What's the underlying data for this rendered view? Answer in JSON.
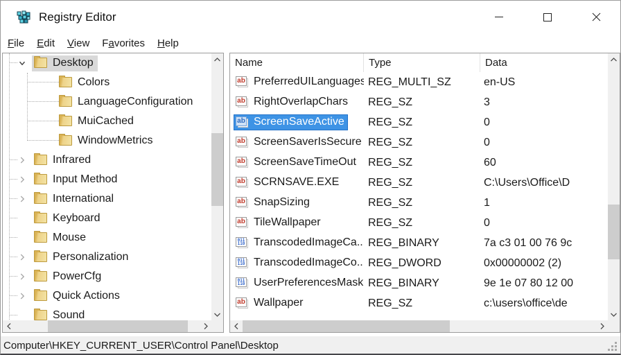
{
  "window": {
    "title": "Registry Editor"
  },
  "titlebar_controls": [
    {
      "name": "minimize-button",
      "icon": "minimize-icon"
    },
    {
      "name": "maximize-button",
      "icon": "maximize-icon"
    },
    {
      "name": "close-button",
      "icon": "close-icon"
    }
  ],
  "menu": {
    "items": [
      {
        "label": "File",
        "underline": 0
      },
      {
        "label": "Edit",
        "underline": 0
      },
      {
        "label": "View",
        "underline": 0
      },
      {
        "label": "Favorites",
        "underline": 1
      },
      {
        "label": "Help",
        "underline": 0
      }
    ]
  },
  "tree": {
    "items": [
      {
        "label": "Desktop",
        "level": 1,
        "expander": "expanded",
        "selected": true
      },
      {
        "label": "Colors",
        "level": 2,
        "expander": "none"
      },
      {
        "label": "LanguageConfiguration",
        "level": 2,
        "expander": "none"
      },
      {
        "label": "MuiCached",
        "level": 2,
        "expander": "none"
      },
      {
        "label": "WindowMetrics",
        "level": 2,
        "expander": "none"
      },
      {
        "label": "Infrared",
        "level": 1,
        "expander": "collapsed"
      },
      {
        "label": "Input Method",
        "level": 1,
        "expander": "collapsed"
      },
      {
        "label": "International",
        "level": 1,
        "expander": "collapsed"
      },
      {
        "label": "Keyboard",
        "level": 1,
        "expander": "none"
      },
      {
        "label": "Mouse",
        "level": 1,
        "expander": "none"
      },
      {
        "label": "Personalization",
        "level": 1,
        "expander": "collapsed"
      },
      {
        "label": "PowerCfg",
        "level": 1,
        "expander": "collapsed"
      },
      {
        "label": "Quick Actions",
        "level": 1,
        "expander": "collapsed"
      },
      {
        "label": "Sound",
        "level": 1,
        "expander": "none"
      }
    ]
  },
  "list": {
    "columns": [
      "Name",
      "Type",
      "Data"
    ],
    "rows": [
      {
        "name": "PreferredUILanguages",
        "type": "REG_MULTI_SZ",
        "data": "en-US",
        "icon": "string"
      },
      {
        "name": "RightOverlapChars",
        "type": "REG_SZ",
        "data": "3",
        "icon": "string"
      },
      {
        "name": "ScreenSaveActive",
        "type": "REG_SZ",
        "data": "0",
        "icon": "string",
        "selected": true
      },
      {
        "name": "ScreenSaverIsSecure",
        "type": "REG_SZ",
        "data": "0",
        "icon": "string"
      },
      {
        "name": "ScreenSaveTimeOut",
        "type": "REG_SZ",
        "data": "60",
        "icon": "string"
      },
      {
        "name": "SCRNSAVE.EXE",
        "type": "REG_SZ",
        "data": "C:\\Users\\Office\\D",
        "icon": "string"
      },
      {
        "name": "SnapSizing",
        "type": "REG_SZ",
        "data": "1",
        "icon": "string"
      },
      {
        "name": "TileWallpaper",
        "type": "REG_SZ",
        "data": "0",
        "icon": "string"
      },
      {
        "name": "TranscodedImageCa...",
        "type": "REG_BINARY",
        "data": "7a c3 01 00 76 9c",
        "icon": "binary"
      },
      {
        "name": "TranscodedImageCo...",
        "type": "REG_DWORD",
        "data": "0x00000002 (2)",
        "icon": "binary"
      },
      {
        "name": "UserPreferencesMask",
        "type": "REG_BINARY",
        "data": "9e 1e 07 80 12 00",
        "icon": "binary"
      },
      {
        "name": "Wallpaper",
        "type": "REG_SZ",
        "data": "c:\\users\\office\\de",
        "icon": "string"
      }
    ]
  },
  "statusbar": {
    "path": "Computer\\HKEY_CURRENT_USER\\Control Panel\\Desktop"
  },
  "colors": {
    "selection_blue": "#3e93e5",
    "selection_gray": "#d9d9d9",
    "folder_yellow": "#eed389",
    "string_icon_red": "#c03a2b",
    "binary_icon_blue": "#2f63c9",
    "scroll_track": "#f0f0f0",
    "scroll_thumb": "#cdcdcd",
    "status_bg": "#f0f0f0"
  }
}
